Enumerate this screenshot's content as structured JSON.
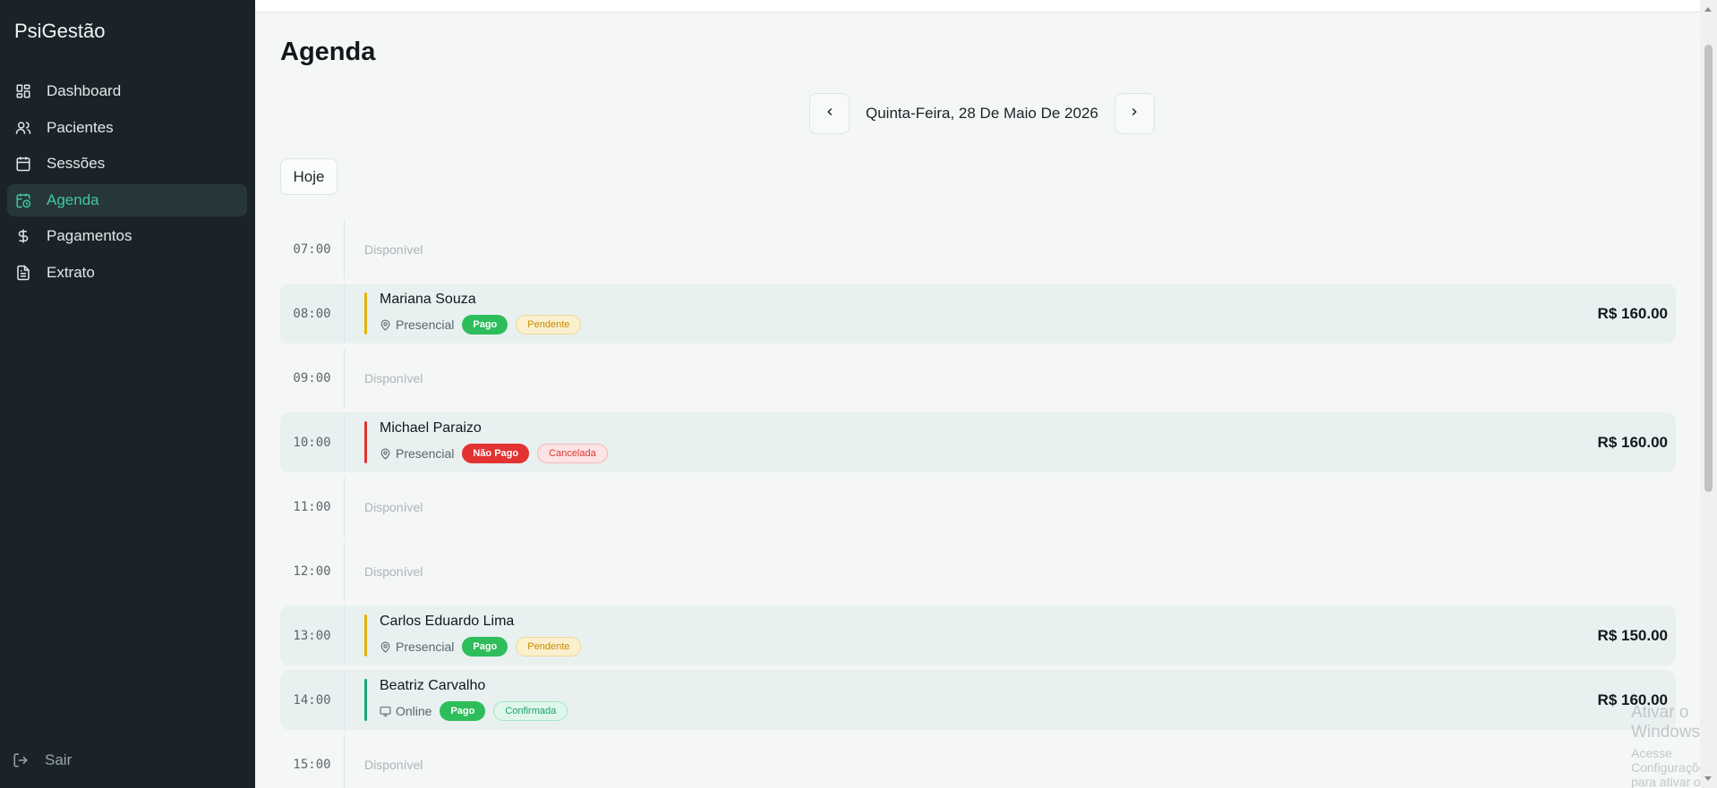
{
  "app": {
    "name": "PsiGestão"
  },
  "sidebar": {
    "items": [
      {
        "label": "Dashboard",
        "icon": "grid-icon"
      },
      {
        "label": "Pacientes",
        "icon": "users-icon"
      },
      {
        "label": "Sessões",
        "icon": "calendar-icon"
      },
      {
        "label": "Agenda",
        "icon": "calendar-clock-icon",
        "active": true
      },
      {
        "label": "Pagamentos",
        "icon": "dollar-icon"
      },
      {
        "label": "Extrato",
        "icon": "file-text-icon"
      }
    ],
    "logout_label": "Sair"
  },
  "page": {
    "title": "Agenda",
    "date_label": "Quinta-Feira, 28 De Maio De 2026",
    "today_label": "Hoje"
  },
  "schedule": {
    "slots": [
      {
        "time": "07:00",
        "status": "Disponível"
      },
      {
        "time": "08:00",
        "patient": "Mariana Souza",
        "mode": "Presencial",
        "mode_icon": "map-pin-icon",
        "payment": "Pago",
        "state": "Pendente",
        "price": "R$ 160.00"
      },
      {
        "time": "09:00",
        "status": "Disponível"
      },
      {
        "time": "10:00",
        "patient": "Michael Paraizo",
        "mode": "Presencial",
        "mode_icon": "map-pin-icon",
        "payment": "Não Pago",
        "state": "Cancelada",
        "price": "R$ 160.00"
      },
      {
        "time": "11:00",
        "status": "Disponível"
      },
      {
        "time": "12:00",
        "status": "Disponível"
      },
      {
        "time": "13:00",
        "patient": "Carlos Eduardo Lima",
        "mode": "Presencial",
        "mode_icon": "map-pin-icon",
        "payment": "Pago",
        "state": "Pendente",
        "price": "R$ 150.00"
      },
      {
        "time": "14:00",
        "patient": "Beatriz Carvalho",
        "mode": "Online",
        "mode_icon": "monitor-icon",
        "payment": "Pago",
        "state": "Confirmada",
        "price": "R$ 160.00"
      },
      {
        "time": "15:00",
        "status": "Disponível"
      }
    ]
  },
  "watermark": {
    "line1": "Ativar o Windows",
    "line2": "Acesse Configurações para ativar o Windows."
  },
  "colors": {
    "sidebar_bg": "#1a2428",
    "accent": "#3ec9a0",
    "pending_bar": "#e8b20b",
    "cancel_bar": "#e23232",
    "confirmed_bar": "#1aa876"
  }
}
